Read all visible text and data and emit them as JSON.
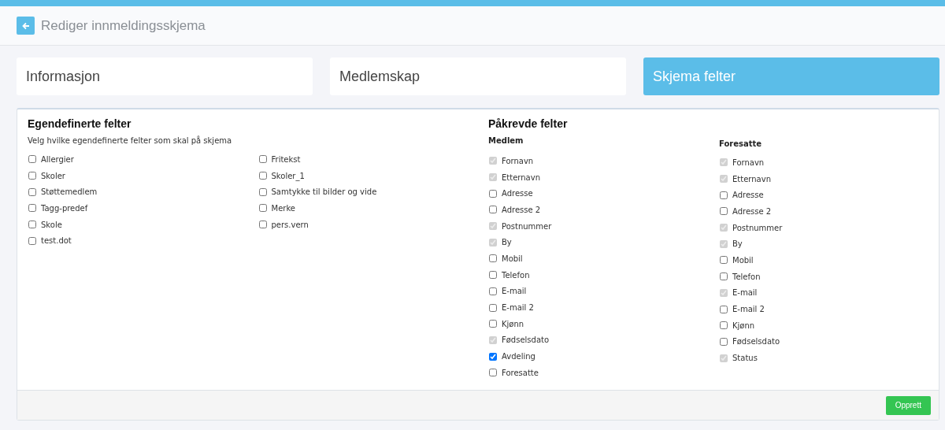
{
  "header": {
    "title": "Rediger innmeldingsskjema"
  },
  "tabs": [
    {
      "label": "Informasjon",
      "selected": false
    },
    {
      "label": "Medlemskap",
      "selected": false
    },
    {
      "label": "Skjema felter",
      "selected": true
    }
  ],
  "custom_fields": {
    "title": "Egendefinerte felter",
    "description": "Velg hvilke egendefinerte felter som skal på skjema",
    "columns": [
      {
        "items": [
          {
            "label": "Allergier",
            "checked": false
          },
          {
            "label": "Skoler",
            "checked": false
          },
          {
            "label": "Støttemedlem",
            "checked": false
          },
          {
            "label": "Tagg-predef",
            "checked": false
          },
          {
            "label": "Skole",
            "checked": false
          },
          {
            "label": "test.dot",
            "checked": false
          }
        ]
      },
      {
        "items": [
          {
            "label": "Fritekst",
            "checked": false
          },
          {
            "label": "Skoler_1",
            "checked": false
          },
          {
            "label": "Samtykke til bilder og vide",
            "checked": false
          },
          {
            "label": "Merke",
            "checked": false
          },
          {
            "label": "pers.vern",
            "checked": false
          }
        ]
      }
    ]
  },
  "required_fields": {
    "title": "Påkrevde felter",
    "groups": [
      {
        "title": "Medlem",
        "items": [
          {
            "label": "Fornavn",
            "checked": true,
            "disabled": true
          },
          {
            "label": "Etternavn",
            "checked": true,
            "disabled": true
          },
          {
            "label": "Adresse",
            "checked": false,
            "disabled": false
          },
          {
            "label": "Adresse 2",
            "checked": false,
            "disabled": false
          },
          {
            "label": "Postnummer",
            "checked": true,
            "disabled": true
          },
          {
            "label": "By",
            "checked": true,
            "disabled": true
          },
          {
            "label": "Mobil",
            "checked": false,
            "disabled": false
          },
          {
            "label": "Telefon",
            "checked": false,
            "disabled": false
          },
          {
            "label": "E-mail",
            "checked": false,
            "disabled": false
          },
          {
            "label": "E-mail 2",
            "checked": false,
            "disabled": false
          },
          {
            "label": "Kjønn",
            "checked": false,
            "disabled": false
          },
          {
            "label": "Fødselsdato",
            "checked": true,
            "disabled": true
          },
          {
            "label": "Avdeling",
            "checked": true,
            "disabled": false
          },
          {
            "label": "Foresatte",
            "checked": false,
            "disabled": false
          }
        ]
      },
      {
        "title": "Foresatte",
        "items": [
          {
            "label": "Fornavn",
            "checked": true,
            "disabled": true
          },
          {
            "label": "Etternavn",
            "checked": true,
            "disabled": true
          },
          {
            "label": "Adresse",
            "checked": false,
            "disabled": false
          },
          {
            "label": "Adresse 2",
            "checked": false,
            "disabled": false
          },
          {
            "label": "Postnummer",
            "checked": true,
            "disabled": true
          },
          {
            "label": "By",
            "checked": true,
            "disabled": true
          },
          {
            "label": "Mobil",
            "checked": false,
            "disabled": false
          },
          {
            "label": "Telefon",
            "checked": false,
            "disabled": false
          },
          {
            "label": "E-mail",
            "checked": true,
            "disabled": true
          },
          {
            "label": "E-mail 2",
            "checked": false,
            "disabled": false
          },
          {
            "label": "Kjønn",
            "checked": false,
            "disabled": false
          },
          {
            "label": "Fødselsdato",
            "checked": false,
            "disabled": false
          },
          {
            "label": "Status",
            "checked": true,
            "disabled": true
          }
        ]
      }
    ]
  },
  "footer": {
    "button": "Opprett"
  }
}
